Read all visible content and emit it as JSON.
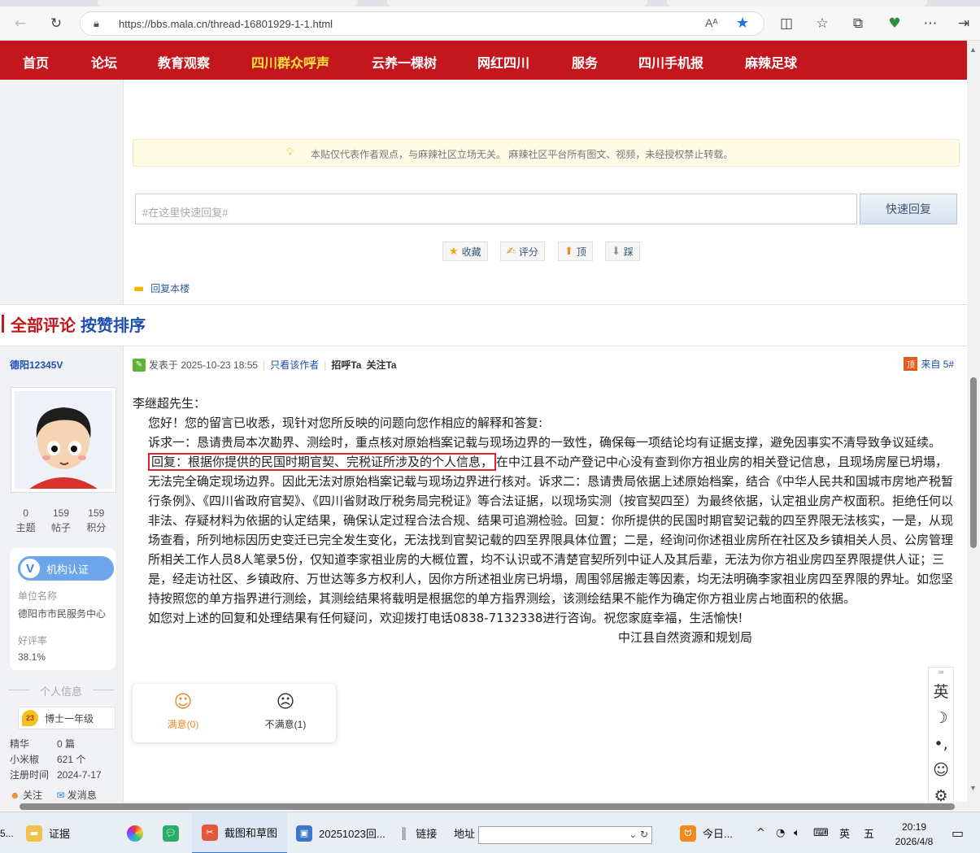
{
  "browser": {
    "url": "https://bbs.mala.cn/thread-16801929-1-1.html",
    "read_aloud": "Aᴬ"
  },
  "sitenav": [
    "首页",
    "论坛",
    "教育观察",
    "四川群众呼声",
    "云养一棵树",
    "网红四川",
    "服务",
    "四川手机报",
    "麻辣足球"
  ],
  "notice": "本贴仅代表作者观点，与麻辣社区立场无关。 麻辣社区平台所有图文、视频，未经授权禁止转载。",
  "quick_reply": {
    "placeholder": "#在这里快速回复#",
    "button": "快速回复"
  },
  "actions": {
    "favorite": "收藏",
    "rate": "评分",
    "up": "顶",
    "down": "踩"
  },
  "reply_floor": "回复本楼",
  "comments": {
    "all": "全部评论",
    "sort": "按赞排序"
  },
  "author": {
    "name": "德阳12345V",
    "stats": [
      {
        "value": "0",
        "label": "主题"
      },
      {
        "value": "159",
        "label": "帖子"
      },
      {
        "value": "159",
        "label": "积分"
      }
    ],
    "org_badge": "机构认证",
    "org_label": "单位名称",
    "org_name": "德阳市市民服务中心",
    "rating_label": "好评率",
    "rating": "38.1%",
    "info_title": "个人信息",
    "level_num": "23",
    "level": "博士一年级",
    "kv": [
      {
        "k": "精华",
        "v": "0 篇"
      },
      {
        "k": "小米椒",
        "v": "621 个"
      },
      {
        "k": "注册时间",
        "v": "2024-7-17"
      }
    ],
    "follow": "关注",
    "message": "发消息"
  },
  "post": {
    "date": "发表于 2025-10-23 18:55",
    "only_author": "只看该作者",
    "greet": "招呼Ta",
    "follow": "关注Ta",
    "tag": "顶",
    "floor": "来自 5#",
    "p1": "李继超先生：",
    "p2": "您好！您的留言已收悉，现针对您所反映的问题向您作相应的解释和答复:",
    "p3a": "诉求一：恳请贵局本次勘界、测绘时，重点核对原始档案记载与现场边界的一致性，确保每一项结论均有证据支撑，避免因事实不清导致争议延续。",
    "p3_highlight": "回复：根据你提供的民国时期官契、完税证所涉及的个人信息，",
    "p3b": "在中江县不动产登记中心没有查到你方祖业房的相关登记信息，且现场房屋已坍塌，无法完全确定现场边界。因此无法对原始档案记载与现场边界进行核对。诉求二：恳请贵局依据上述原始档案，结合《中华人民共和国城市房地产税暂行条例》、《四川省政府官契》、《四川省财政厅税务局完税证》等合法证据，以现场实测（按官契四至）为最终依据，认定祖业房产权面积。拒绝任何以非法、存疑材料为依据的认定结果，确保认定过程合法合规、结果可追溯检验。回复：你所提供的民国时期官契记载的四至界限无法核实，一是，从现场查看，所列地标因历史变迁已完全发生变化，无法找到官契记载的四至界限具体位置；二是，经询问你述祖业房所在社区及乡镇相关人员、公房管理所相关工作人员8人笔录5份，仅知道李家祖业房的大概位置，均不认识或不清楚官契所列中证人及其后辈，无法为你方祖业房四至界限提供人证；三是，经走访社区、乡镇政府、万世达等多方权利人，因你方所述祖业房已坍塌，周围邻居搬走等因素，均无法明确李家祖业房四至界限的界址。如您坚持按照您的单方指界进行测绘，其测绘结果将载明是根据您的单方指界测绘，该测绘结果不能作为确定你方祖业房占地面积的依据。",
    "p4": "如您对上述的回复和处理结果有任何疑问，欢迎拨打电话0838-7132338进行咨询。祝您家庭幸福，生活愉快!",
    "sign": "中江县自然资源和规划局"
  },
  "vote": {
    "satisfied": "满意(0)",
    "unsatisfied": "不满意(1)"
  },
  "widgets": [
    "英",
    "☽",
    "•,",
    "☺",
    "⚙"
  ],
  "taskbar": {
    "evidence": "证据",
    "snip": "截图和草图",
    "img": "20251023回...",
    "links": "链接",
    "address": "地址",
    "today": "今日...",
    "ime1": "英",
    "ime2": "五",
    "time": "20:19",
    "date": "2026/4/8"
  }
}
